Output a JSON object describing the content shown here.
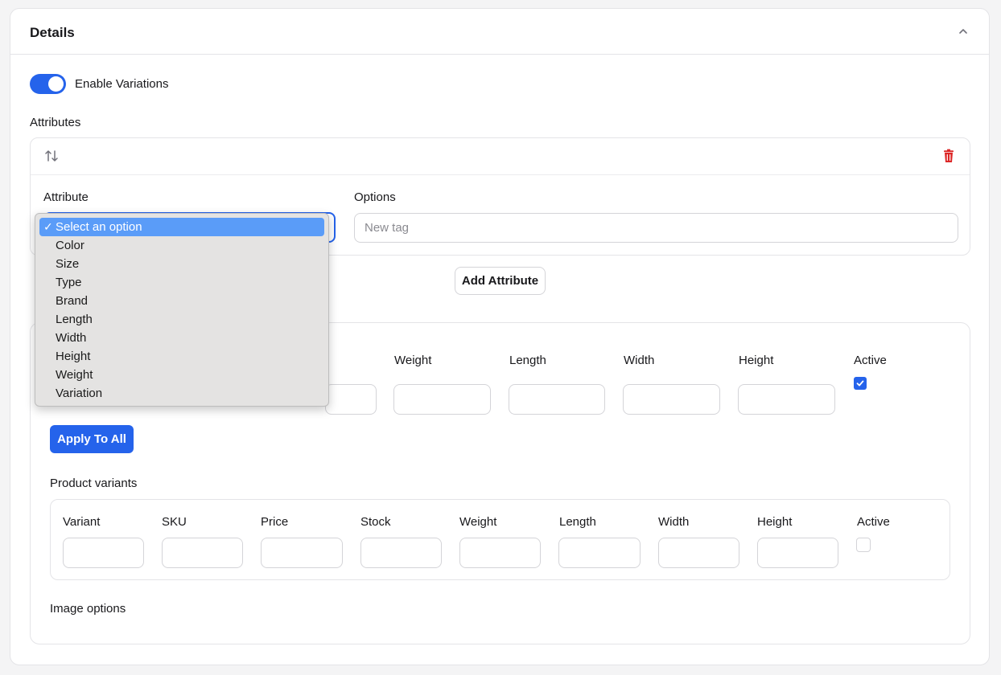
{
  "panel": {
    "title": "Details",
    "collapse_icon": "chevron-up-icon"
  },
  "variations_toggle": {
    "label": "Enable Variations",
    "enabled": true
  },
  "attributes": {
    "heading": "Attributes",
    "card": {
      "sort_icon": "sort-arrows-icon",
      "delete_icon": "trash-icon",
      "attribute_label": "Attribute",
      "options_label": "Options",
      "options_placeholder": "New tag"
    },
    "add_button": "Add Attribute"
  },
  "attribute_dropdown": {
    "selected": "Select an option",
    "options": [
      "Select an option",
      "Color",
      "Size",
      "Type",
      "Brand",
      "Length",
      "Width",
      "Height",
      "Weight",
      "Variation"
    ]
  },
  "bulk_fields": {
    "columns": [
      "Weight",
      "Length",
      "Width",
      "Height"
    ],
    "active_label": "Active",
    "active_checked": true,
    "apply_button": "Apply To All"
  },
  "product_variants": {
    "heading": "Product variants",
    "columns": [
      "Variant",
      "SKU",
      "Price",
      "Stock",
      "Weight",
      "Length",
      "Width",
      "Height"
    ],
    "active_label": "Active",
    "active_checked": false
  },
  "image_options": {
    "heading": "Image options"
  },
  "colors": {
    "accent": "#2563eb",
    "danger": "#dc2626",
    "dropdown_highlight": "#5a9cf8"
  }
}
